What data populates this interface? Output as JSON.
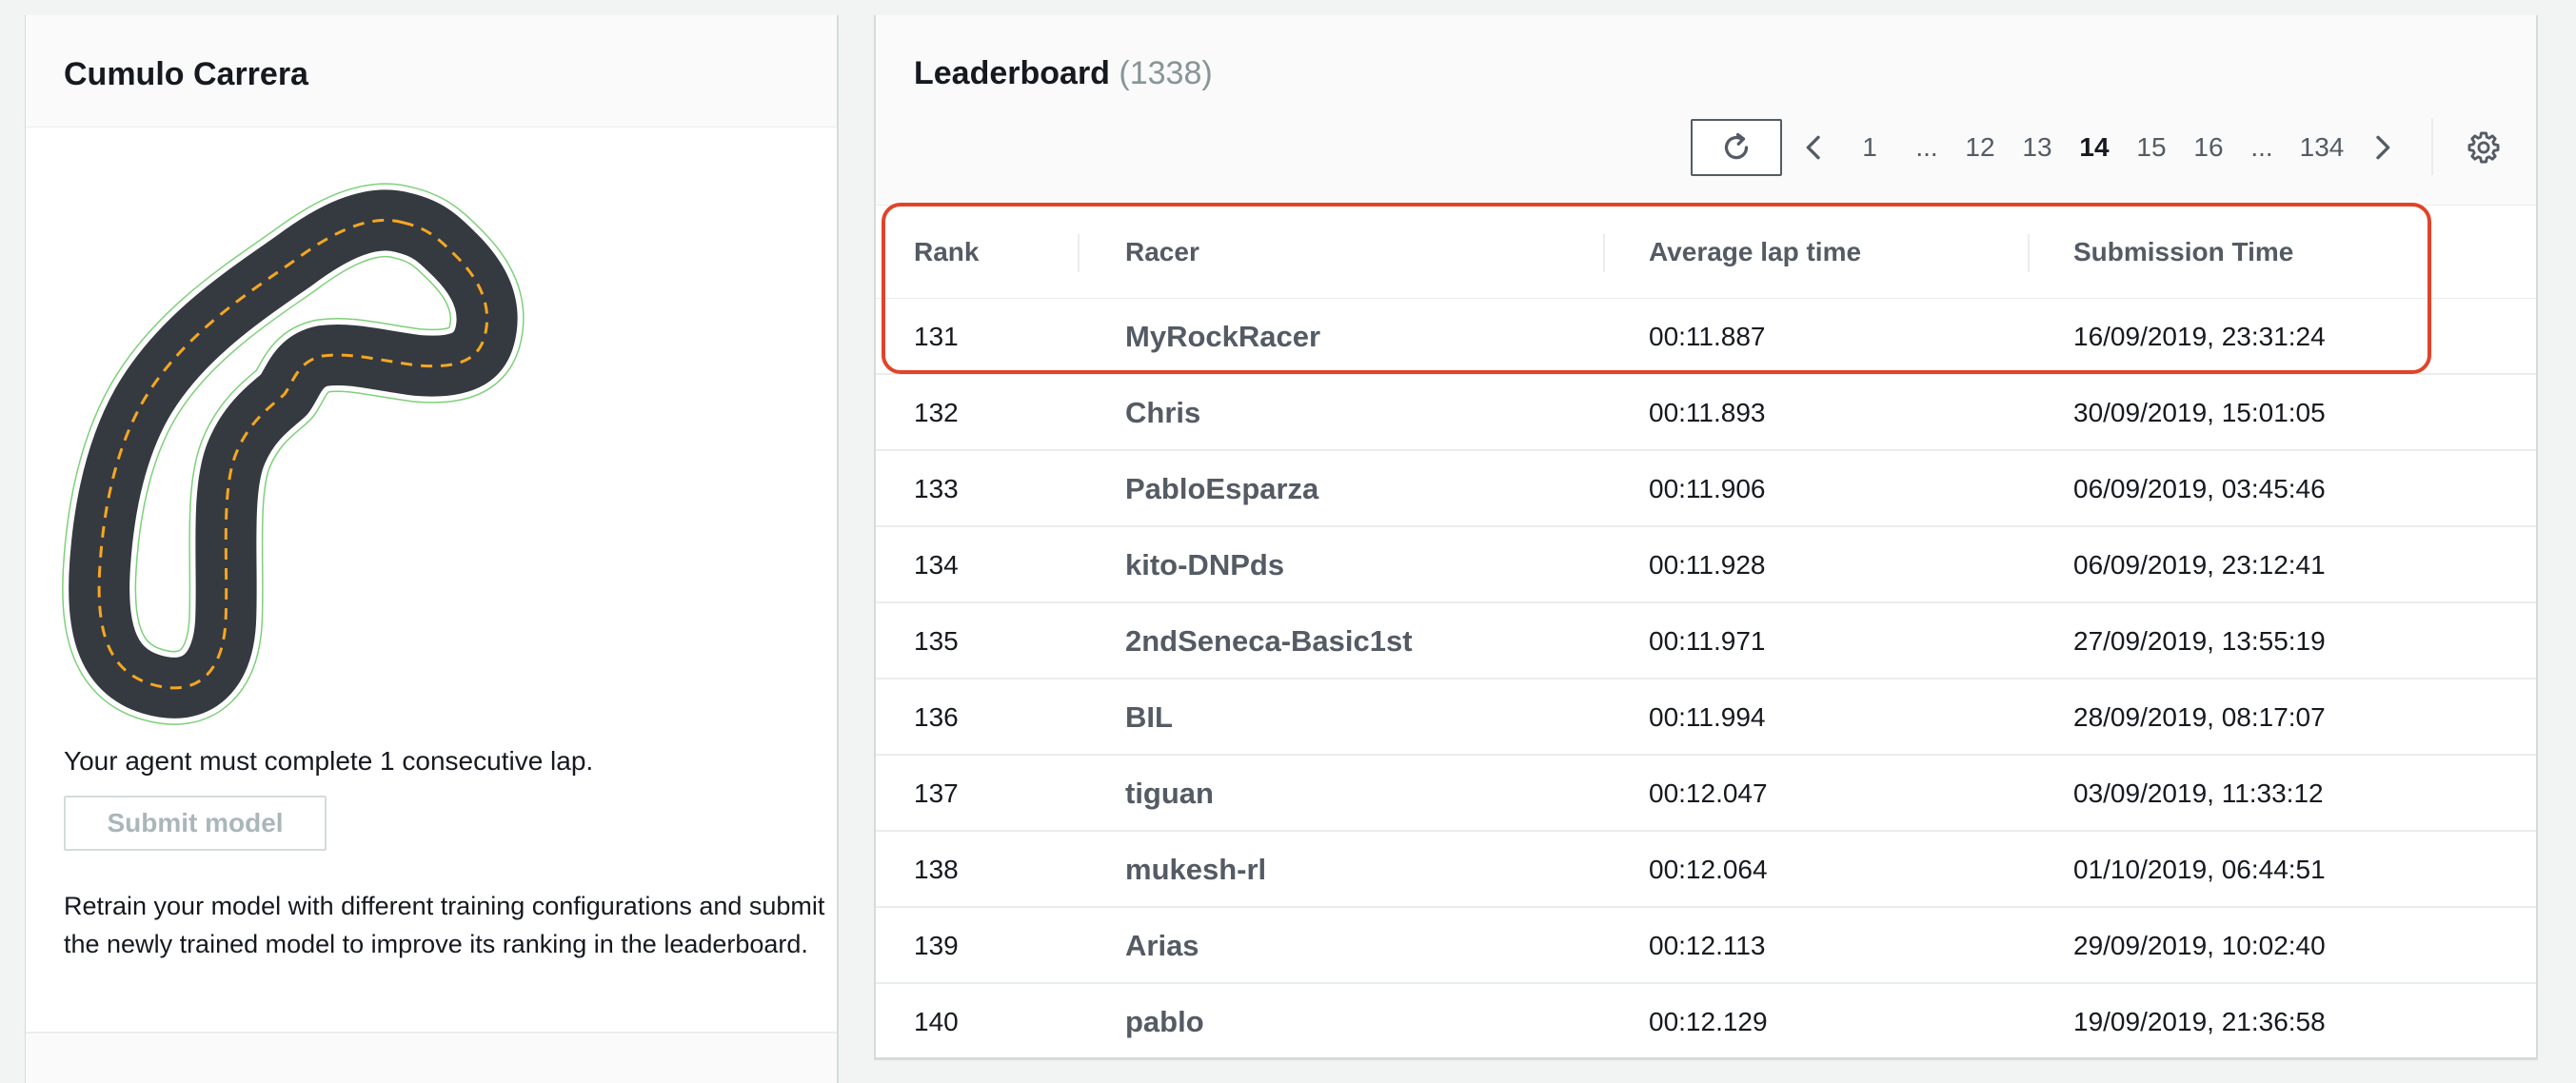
{
  "left_panel": {
    "title": "Cumulo Carrera",
    "requirement": "Your agent must complete 1 consecutive lap.",
    "submit_label": "Submit model",
    "retrain_text": "Retrain your model with different training configurations and submit the newly trained model to improve its ranking in the leaderboard."
  },
  "leaderboard": {
    "title": "Leaderboard",
    "count": "(1338)",
    "pagination": {
      "pages": [
        "1",
        "...",
        "12",
        "13",
        "14",
        "15",
        "16",
        "...",
        "134"
      ],
      "current": "14"
    },
    "columns": [
      "Rank",
      "Racer",
      "Average lap time",
      "Submission Time"
    ],
    "rows": [
      {
        "rank": "131",
        "racer": "MyRockRacer",
        "lap": "00:11.887",
        "time": "16/09/2019, 23:31:24"
      },
      {
        "rank": "132",
        "racer": "Chris",
        "lap": "00:11.893",
        "time": "30/09/2019, 15:01:05"
      },
      {
        "rank": "133",
        "racer": "PabloEsparza",
        "lap": "00:11.906",
        "time": "06/09/2019, 03:45:46"
      },
      {
        "rank": "134",
        "racer": "kito-DNPds",
        "lap": "00:11.928",
        "time": "06/09/2019, 23:12:41"
      },
      {
        "rank": "135",
        "racer": "2ndSeneca-Basic1st",
        "lap": "00:11.971",
        "time": "27/09/2019, 13:55:19"
      },
      {
        "rank": "136",
        "racer": "BIL",
        "lap": "00:11.994",
        "time": "28/09/2019, 08:17:07"
      },
      {
        "rank": "137",
        "racer": "tiguan",
        "lap": "00:12.047",
        "time": "03/09/2019, 11:33:12"
      },
      {
        "rank": "138",
        "racer": "mukesh-rl",
        "lap": "00:12.064",
        "time": "01/10/2019, 06:44:51"
      },
      {
        "rank": "139",
        "racer": "Arias",
        "lap": "00:12.113",
        "time": "29/09/2019, 10:02:40"
      },
      {
        "rank": "140",
        "racer": "pablo",
        "lap": "00:12.129",
        "time": "19/09/2019, 21:36:58"
      }
    ]
  },
  "icons": {
    "refresh": "refresh-icon",
    "prev": "chevron-left-icon",
    "next": "chevron-right-icon",
    "settings": "gear-icon"
  },
  "colors": {
    "highlight": "#e0442a",
    "track": "#343a40",
    "track_dash": "#f5a623",
    "track_outline": "#7ed07a"
  }
}
